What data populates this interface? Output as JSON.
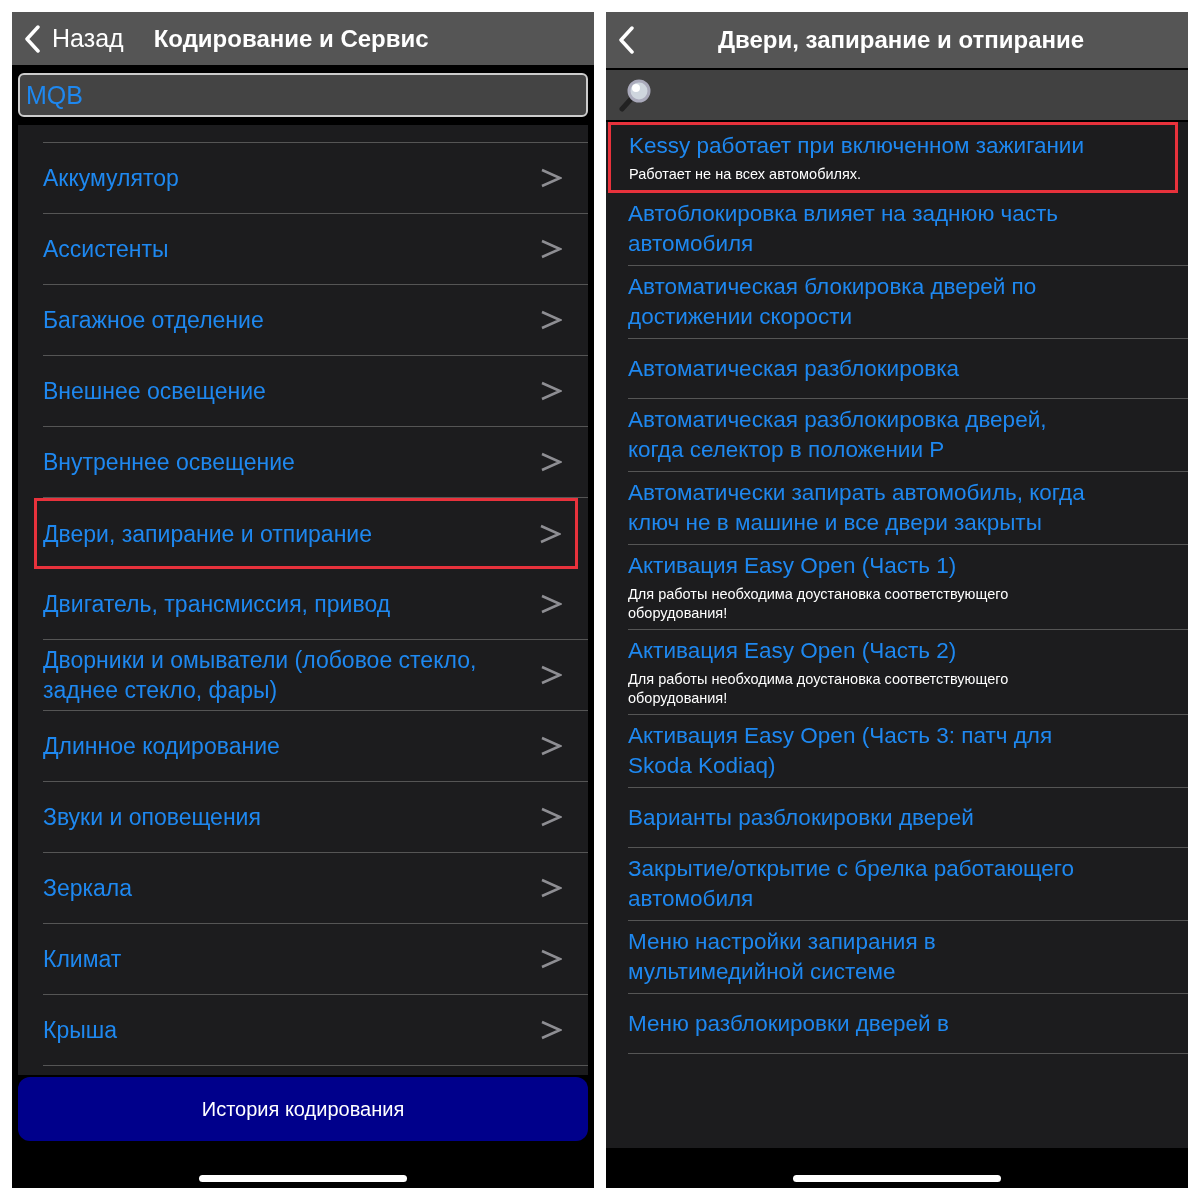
{
  "left_screen": {
    "back_button": "Назад",
    "title": "Кодирование и Сервис",
    "search": {
      "value": "MQB"
    },
    "items": [
      {
        "label": "Аккумулятор",
        "highlighted": false
      },
      {
        "label": "Ассистенты",
        "highlighted": false
      },
      {
        "label": "Багажное отделение",
        "highlighted": false
      },
      {
        "label": "Внешнее освещение",
        "highlighted": false
      },
      {
        "label": "Внутреннее освещение",
        "highlighted": false
      },
      {
        "label": "Двери, запирание и отпирание",
        "highlighted": true
      },
      {
        "label": "Двигатель, трансмиссия, привод",
        "highlighted": false
      },
      {
        "label": "Дворники и омыватели (лобовое стекло, заднее стекло, фары)",
        "highlighted": false
      },
      {
        "label": "Длинное кодирование",
        "highlighted": false
      },
      {
        "label": "Звуки и оповещения",
        "highlighted": false
      },
      {
        "label": "Зеркала",
        "highlighted": false
      },
      {
        "label": "Климат",
        "highlighted": false
      },
      {
        "label": "Крыша",
        "highlighted": false
      }
    ],
    "history_button": "История кодирования"
  },
  "right_screen": {
    "title": "Двери, запирание и отпирание",
    "items": [
      {
        "label": "Kessy работает при включенном зажигании",
        "note": "Работает не на всех автомобилях.",
        "highlighted": true
      },
      {
        "label": "Автоблокировка влияет на заднюю часть автомобиля",
        "highlighted": false
      },
      {
        "label": "Автоматическая блокировка дверей по достижении скорости",
        "highlighted": false
      },
      {
        "label": "Автоматическая разблокировка",
        "highlighted": false
      },
      {
        "label": "Автоматическая разблокировка дверей, когда селектор в положении P",
        "highlighted": false
      },
      {
        "label": "Автоматически запирать автомобиль, когда ключ не в машине и все двери закрыты",
        "highlighted": false
      },
      {
        "label": "Активация Easy Open (Часть 1)",
        "note": "Для работы необходима доустановка соответствующего оборудования!",
        "highlighted": false
      },
      {
        "label": "Активация Easy Open (Часть 2)",
        "note": "Для работы необходима доустановка соответствующего оборудования!",
        "highlighted": false
      },
      {
        "label": "Активация Easy Open (Часть 3: патч для Skoda Kodiaq)",
        "highlighted": false
      },
      {
        "label": "Варианты разблокировки дверей",
        "highlighted": false
      },
      {
        "label": "Закрытие/открытие с брелка работающего автомобиля",
        "highlighted": false
      },
      {
        "label": "Меню настройки запирания в мультимедийной системе",
        "highlighted": false
      },
      {
        "label": "Меню разблокировки дверей в",
        "highlighted": false
      }
    ]
  }
}
